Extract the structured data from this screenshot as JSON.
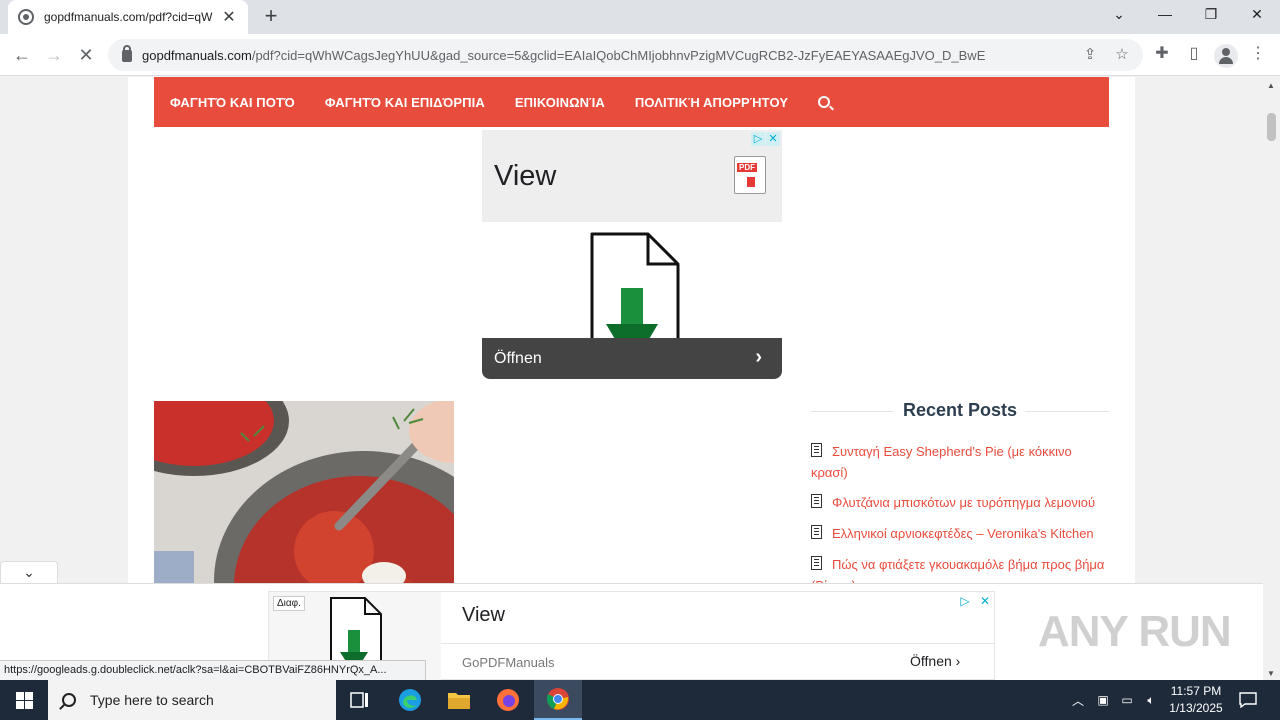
{
  "browser": {
    "tab_title": "gopdfmanuals.com/pdf?cid=qW",
    "url_host": "gopdfmanuals.com",
    "url_path": "/pdf?cid=qWhWCagsJegYhUU&gad_source=5&gclid=EAIaIQobChMIjobhnvPzigMVCugRCB2-JzFyEAEYASAAEgJVO_D_BwE",
    "status_url": "https://googleads.g.doubleclick.net/aclk?sa=l&ai=CBOTBVaiFZ86HNYrQx_A..."
  },
  "site": {
    "nav": [
      "ΦΑΓΗΤΌ ΚΑΙ ΠΟΤΌ",
      "ΦΑΓΗΤΌ ΚΑΙ ΕΠΙΔΌΡΠΙΑ",
      "ΕΠΙΚΟΙΝΩΝΊΑ",
      "ΠΟΛΙΤΙΚΉ ΑΠΟΡΡΉΤΟΥ"
    ],
    "accent_color": "#e84c3d"
  },
  "ad_top": {
    "headline": "View",
    "pdf_label": "PDF",
    "cta": "Öffnen"
  },
  "sidebar": {
    "title": "Recent Posts",
    "posts": [
      "Συνταγή Easy Shepherd's Pie (με κόκκινο κρασί)",
      "Φλυτζάνια μπισκότων με τυρόπηγμα λεμονιού",
      "Ελληνικοί αρνιοκεφτέδες – Veronika's Kitchen",
      "Πώς να φτιάξετε γκουακαμόλε βήμα προς βήμα (Βίντεο)"
    ]
  },
  "ad_bottom": {
    "badge": "Διαφ.",
    "headline": "View",
    "advertiser": "GoPDFManuals",
    "cta": "Öffnen"
  },
  "watermark": "ANY RUN",
  "taskbar": {
    "search_placeholder": "Type here to search",
    "time": "11:57 PM",
    "date": "1/13/2025"
  }
}
